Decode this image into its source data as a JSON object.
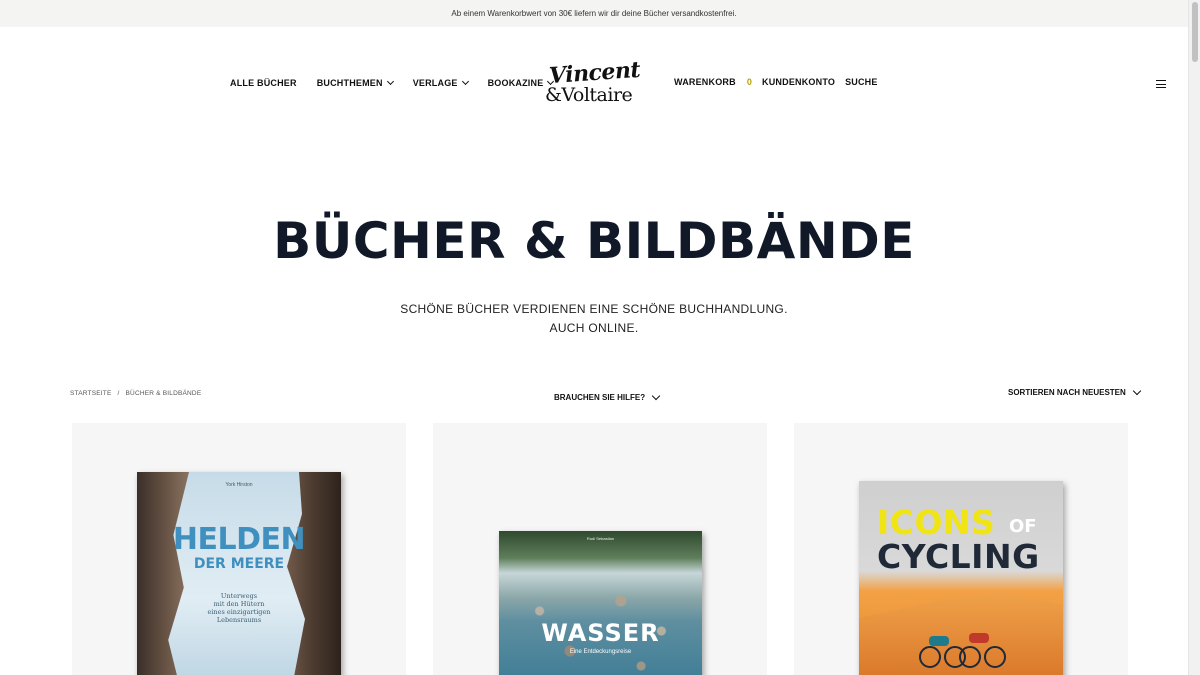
{
  "announcement": "Ab einem Warenkorbwert von 30€ liefern wir dir deine Bücher versandkostenfrei.",
  "nav_left": [
    {
      "label": "ALLE BÜCHER",
      "has_dropdown": false
    },
    {
      "label": "BUCHTHEMEN",
      "has_dropdown": true
    },
    {
      "label": "VERLAGE",
      "has_dropdown": true
    },
    {
      "label": "BOOKAZINE",
      "has_dropdown": true
    }
  ],
  "logo": {
    "line1": "Vincent",
    "line2": "&Voltaire"
  },
  "nav_right": {
    "cart_label": "WARENKORB",
    "cart_count": "0",
    "account_label": "KUNDENKONTO",
    "search_label": "SUCHE"
  },
  "icons": {
    "menu": "hamburger-icon",
    "dropdown": "chevron-down-icon"
  },
  "hero": {
    "title": "BÜCHER & BILDBÄNDE",
    "subtitle_line1": "SCHÖNE BÜCHER VERDIENEN EINE SCHÖNE BUCHHANDLUNG.",
    "subtitle_line2": "AUCH ONLINE."
  },
  "breadcrumb": {
    "home": "STARTSEITE",
    "separator": "/",
    "current": "BÜCHER & BILDBÄNDE"
  },
  "help_label": "BRAUCHEN SIE HILFE?",
  "sort_label": "SORTIEREN NACH NEUESTEN",
  "products": [
    {
      "cover_publisher": "York Hirston",
      "cover_title_line1": "HELDEN",
      "cover_title_line2": "DER MEERE",
      "cover_subtitle": "Unterwegs\nmit den Hütern\neines einzigartigen\nLebensraums"
    },
    {
      "cover_publisher": "Rudi Sebastian",
      "cover_title_line1": "WASSER",
      "cover_subtitle": "Eine Entdeckungsreise"
    },
    {
      "cover_title_line1": "ICONS",
      "cover_title_of": "OF",
      "cover_title_line2": "CYCLING"
    }
  ],
  "colors": {
    "accent_cart_count": "#b8a200",
    "title": "#111827",
    "card_bg": "#f6f6f6",
    "topbar_bg": "#f4f4f2"
  }
}
